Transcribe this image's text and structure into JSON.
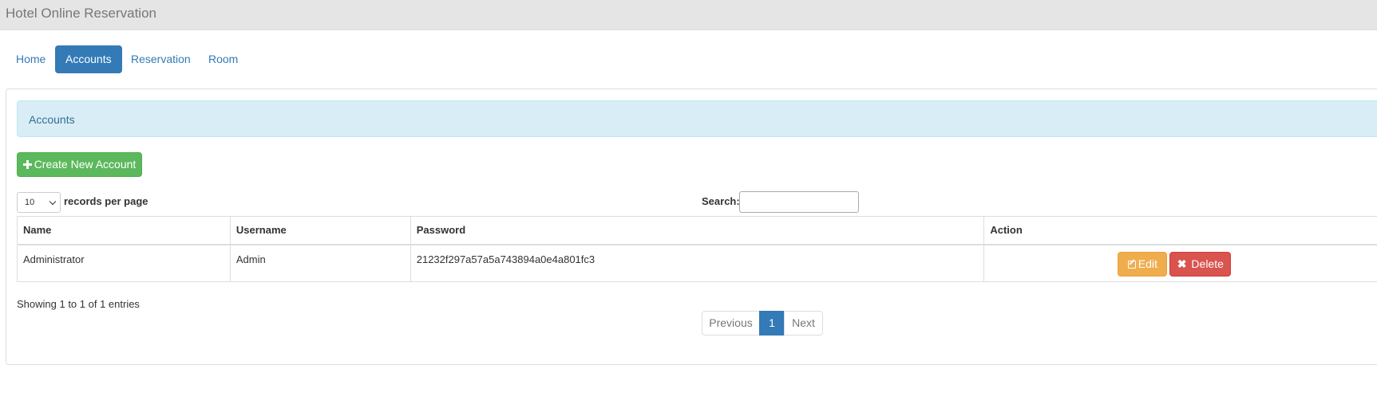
{
  "app": {
    "title": "Hotel Online Reservation"
  },
  "nav": {
    "items": [
      {
        "label": "Home"
      },
      {
        "label": "Accounts",
        "active": true
      },
      {
        "label": "Reservation"
      },
      {
        "label": "Room"
      }
    ]
  },
  "panel": {
    "heading": "Accounts"
  },
  "toolbar": {
    "create_label": "Create New Account",
    "create_icon": "plus-icon"
  },
  "datatable": {
    "length_value": "10",
    "length_label": "records per page",
    "search_label": "Search:",
    "search_value": "",
    "columns": [
      "Name",
      "Username",
      "Password",
      "Action"
    ],
    "rows": [
      {
        "name": "Administrator",
        "username": "Admin",
        "password": "21232f297a57a5a743894a0e4a801fc3",
        "edit_label": "Edit",
        "delete_label": "Delete"
      }
    ],
    "info": "Showing 1 to 1 of 1 entries",
    "pagination": {
      "previous": "Previous",
      "current": "1",
      "next": "Next"
    }
  },
  "colors": {
    "primary": "#337ab7",
    "success": "#5cb85c",
    "warning": "#f0ad4e",
    "danger": "#d9534f",
    "info_bg": "#d9edf7",
    "info_text": "#31708f"
  },
  "icons": {
    "edit": "edit-icon",
    "delete": "times-icon"
  }
}
